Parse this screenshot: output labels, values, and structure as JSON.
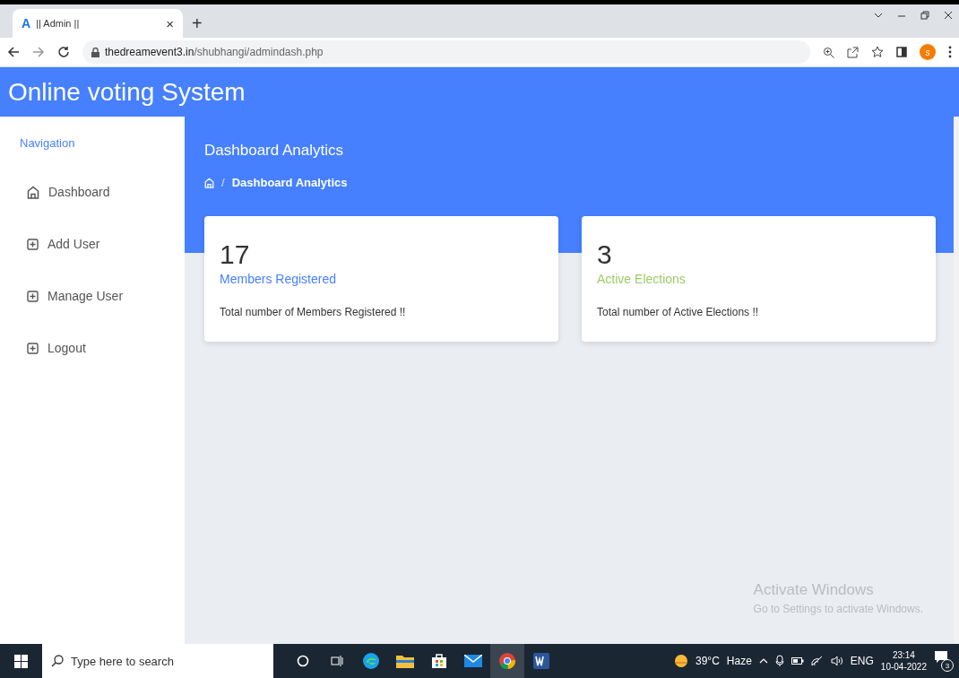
{
  "browser": {
    "favicon": "A",
    "tab_title": "|| Admin ||",
    "tab_close": "×",
    "new_tab": "+",
    "url_domain": "thedreamevent3.in",
    "url_path": "/shubhangi/admindash.php",
    "profile": "s"
  },
  "app": {
    "title": "Online voting System"
  },
  "sidebar": {
    "heading": "Navigation",
    "items": [
      {
        "label": "Dashboard",
        "kind": "home"
      },
      {
        "label": "Add User",
        "kind": "plus"
      },
      {
        "label": "Manage User",
        "kind": "plus"
      },
      {
        "label": "Logout",
        "kind": "plus"
      }
    ]
  },
  "page": {
    "title": "Dashboard Analytics",
    "breadcrumb": "Dashboard Analytics",
    "breadcrumb_separator": "/"
  },
  "cards": [
    {
      "value": "17",
      "label": "Members Registered",
      "color": "#4680ff",
      "description": "Total number of Members Registered !!"
    },
    {
      "value": "3",
      "label": "Active Elections",
      "color": "#9ccc65",
      "description": "Total number of Active Elections !!"
    }
  ],
  "activation_notice": {
    "title": "Activate Windows",
    "subtitle": "Go to Settings to activate Windows."
  },
  "taskbar": {
    "search_placeholder": "Type here to search",
    "temperature": "39°C",
    "weather": "Haze",
    "language": "ENG",
    "time": "23:14",
    "date": "10-04-2022",
    "notifications": "3"
  }
}
